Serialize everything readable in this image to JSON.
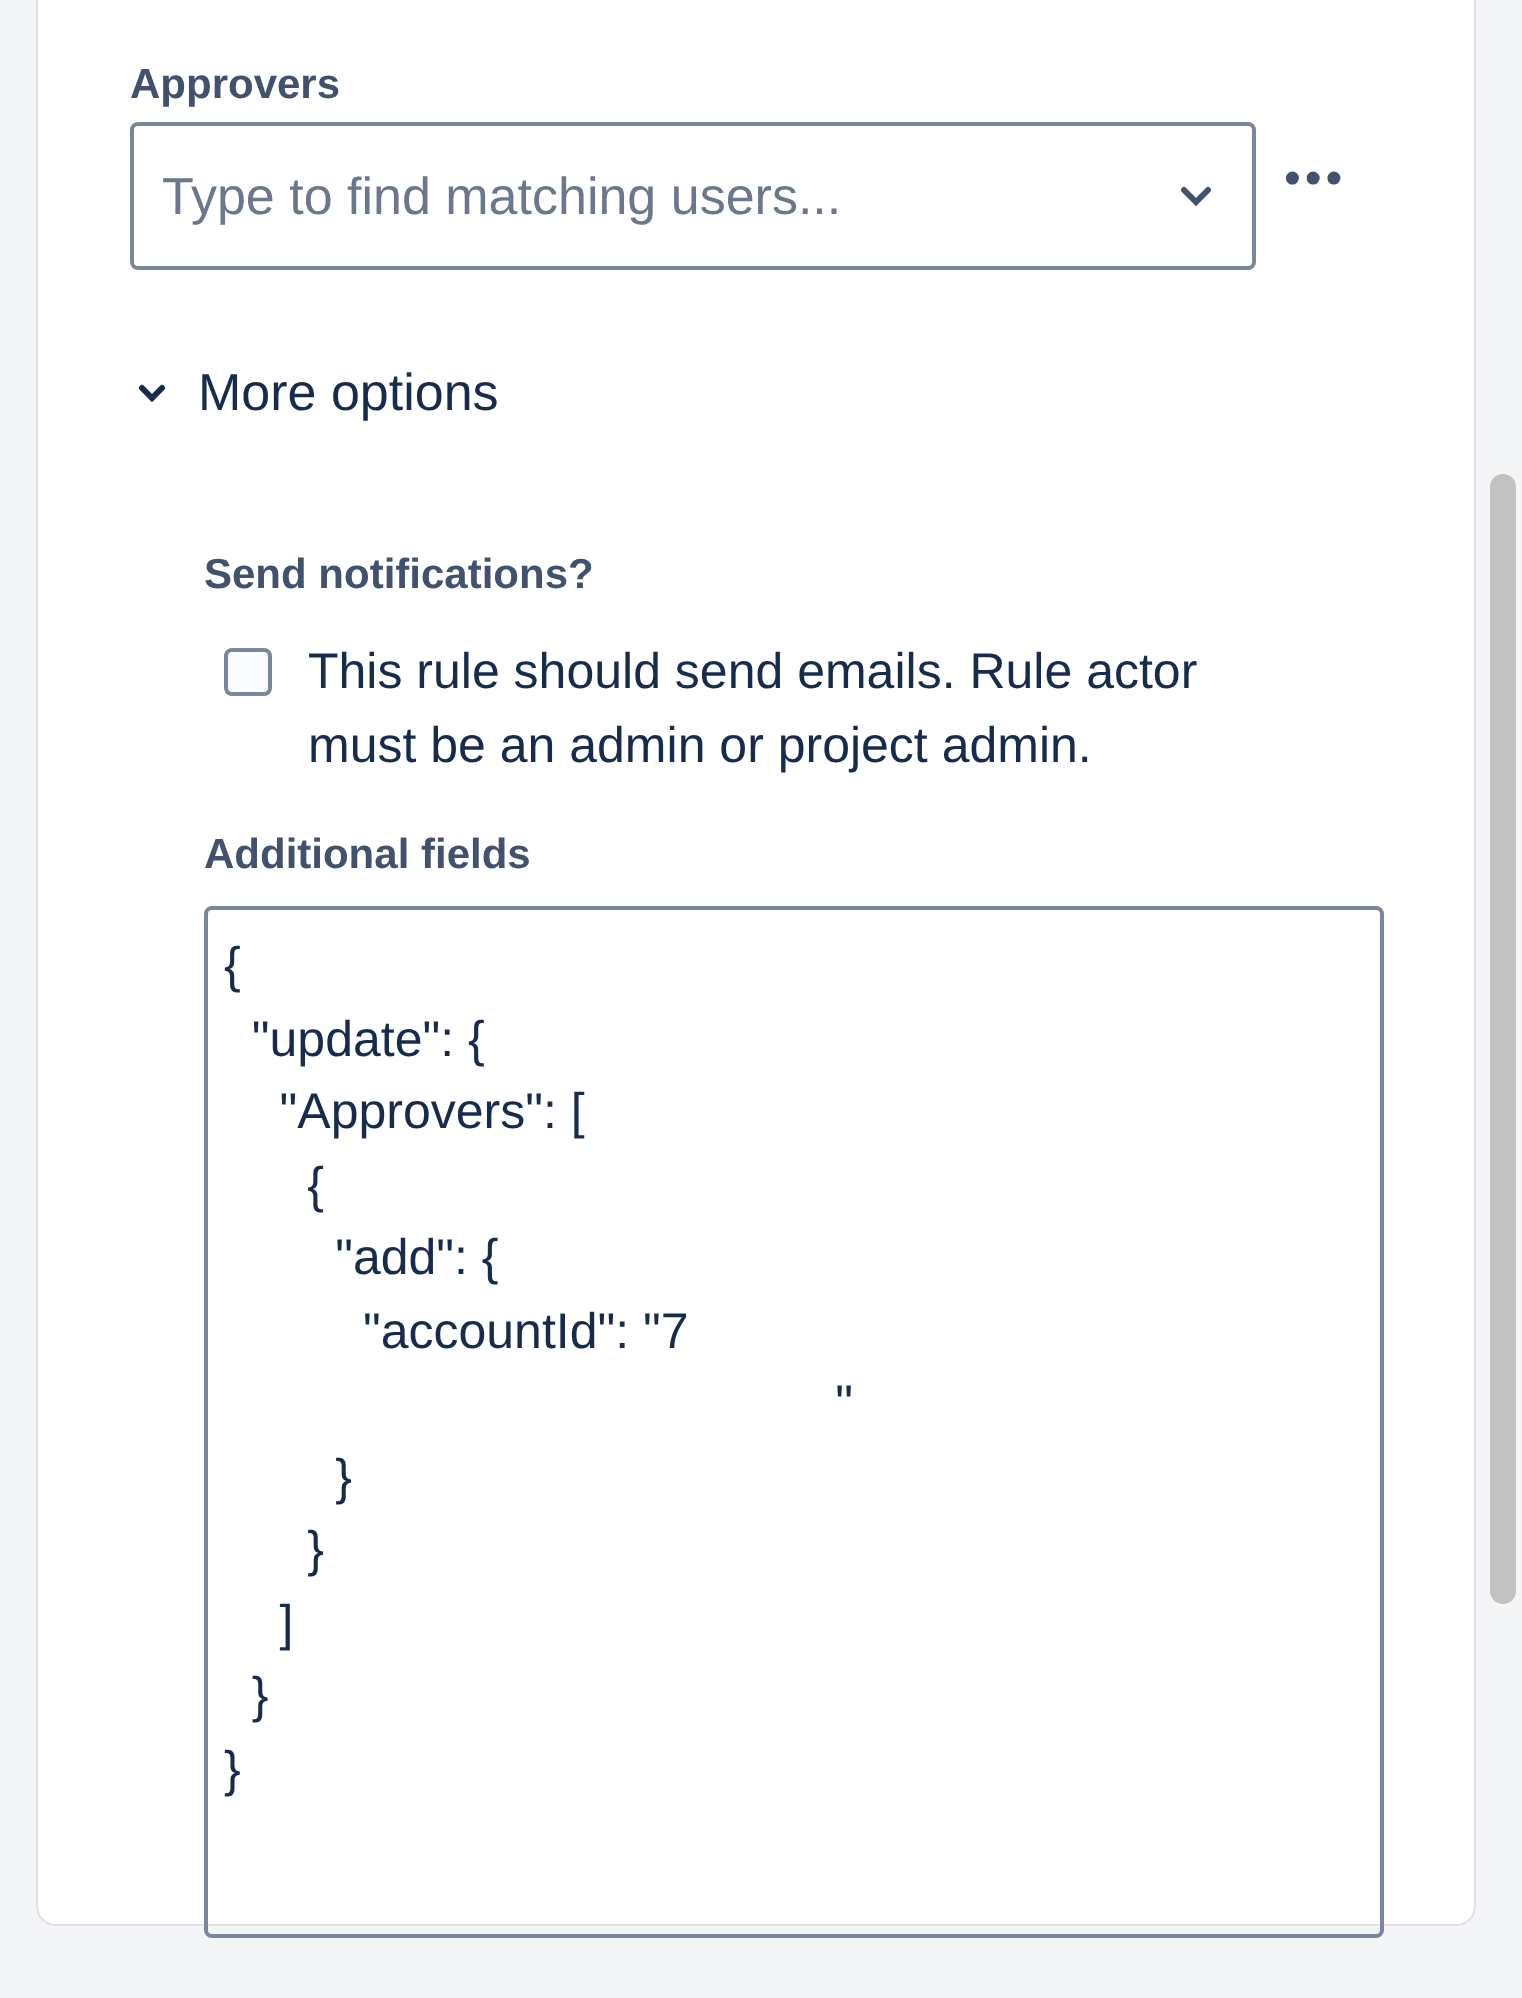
{
  "approvers": {
    "label": "Approvers",
    "placeholder": "Type to find matching users...",
    "more_icon": "•••"
  },
  "more_options": {
    "label": "More options",
    "expanded": true
  },
  "send_notifications": {
    "label": "Send notifications?",
    "checkbox_label": "This rule should send emails. Rule actor must be an admin or project admin.",
    "checked": false
  },
  "additional_fields": {
    "label": "Additional fields",
    "value": "{\n  \"update\": {\n    \"Approvers\": [\n      {\n        \"add\": {\n          \"accountId\": \"7\n                                            \"\n        }\n      }\n    ]\n  }\n}"
  }
}
